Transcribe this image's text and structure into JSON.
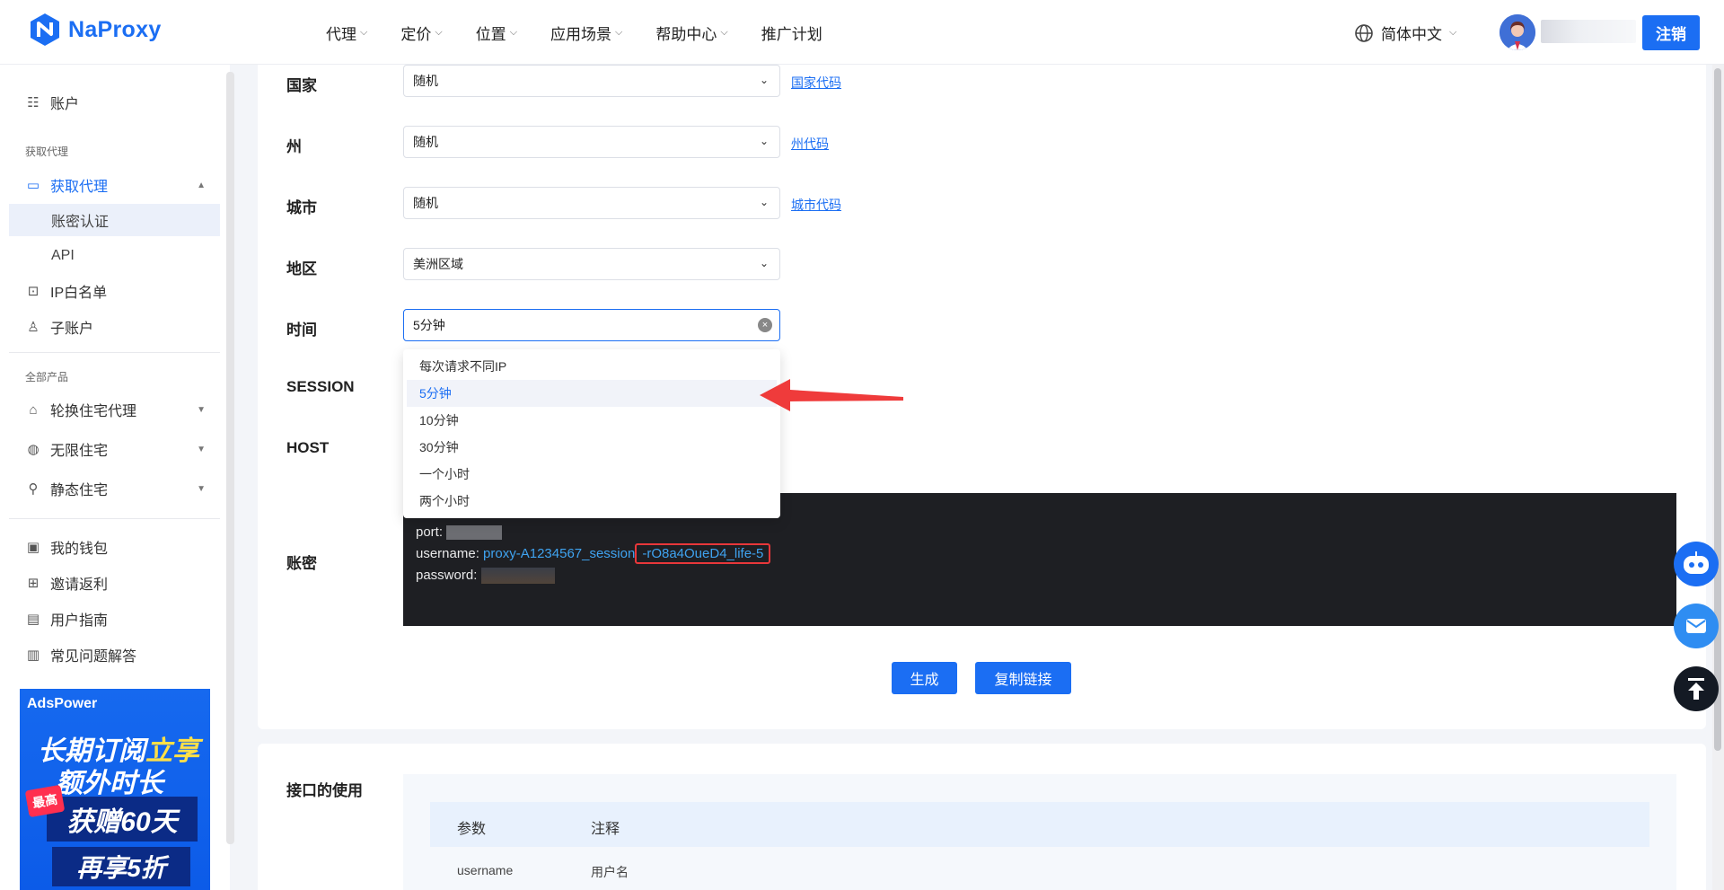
{
  "header": {
    "brand": "NaProxy",
    "nav": [
      {
        "label": "代理",
        "has_dropdown": true
      },
      {
        "label": "定价",
        "has_dropdown": true
      },
      {
        "label": "位置",
        "has_dropdown": true
      },
      {
        "label": "应用场景",
        "has_dropdown": true
      },
      {
        "label": "帮助中心",
        "has_dropdown": true
      },
      {
        "label": "推广计划",
        "has_dropdown": false
      }
    ],
    "language": "简体中文",
    "logout_label": "注销",
    "accent_color": "#1b6ef3"
  },
  "sidebar": {
    "account": "账户",
    "group_get_proxy": "获取代理",
    "get_proxy": "获取代理",
    "sub_auth": "账密认证",
    "sub_api": "API",
    "ip_whitelist": "IP白名单",
    "sub_account": "子账户",
    "group_all_products": "全部产品",
    "rotating_residential": "轮换住宅代理",
    "unlimited_residential": "无限住宅",
    "static_residential": "静态住宅",
    "wallet": "我的钱包",
    "invite_rebate": "邀请返利",
    "user_guide": "用户指南",
    "faq": "常见问题解答",
    "ad": {
      "brand": "AdsPower",
      "line1_a": "长期订阅",
      "line1_b": "立享",
      "line2": "额外时长",
      "badge": "最高",
      "box1": "获赠60天",
      "box2": "再享5折"
    }
  },
  "form": {
    "country_label": "国家",
    "country_value": "随机",
    "country_link": "国家代码",
    "state_label": "州",
    "state_value": "随机",
    "state_link": "州代码",
    "city_label": "城市",
    "city_value": "随机",
    "city_link": "城市代码",
    "region_label": "地区",
    "region_value": "美洲区域",
    "time_label": "时间",
    "time_value": "5分钟",
    "session_label": "SESSION",
    "host_label": "HOST",
    "credentials_label": "账密",
    "time_options": [
      "每次请求不同IP",
      "5分钟",
      "10分钟",
      "30分钟",
      "一个小时",
      "两个小时"
    ],
    "time_selected_index": 1
  },
  "code_block": {
    "port_key": "port:",
    "username_key": "username:",
    "username_prefix": "proxy-A1234567_session",
    "username_highlight": "-rO8a4OueD4_life-5",
    "password_key": "password:"
  },
  "actions": {
    "generate": "生成",
    "copy_link": "复制链接"
  },
  "api_usage": {
    "title": "接口的使用",
    "columns": [
      "参数",
      "注释"
    ],
    "rows": [
      [
        "username",
        "用户名"
      ]
    ]
  }
}
